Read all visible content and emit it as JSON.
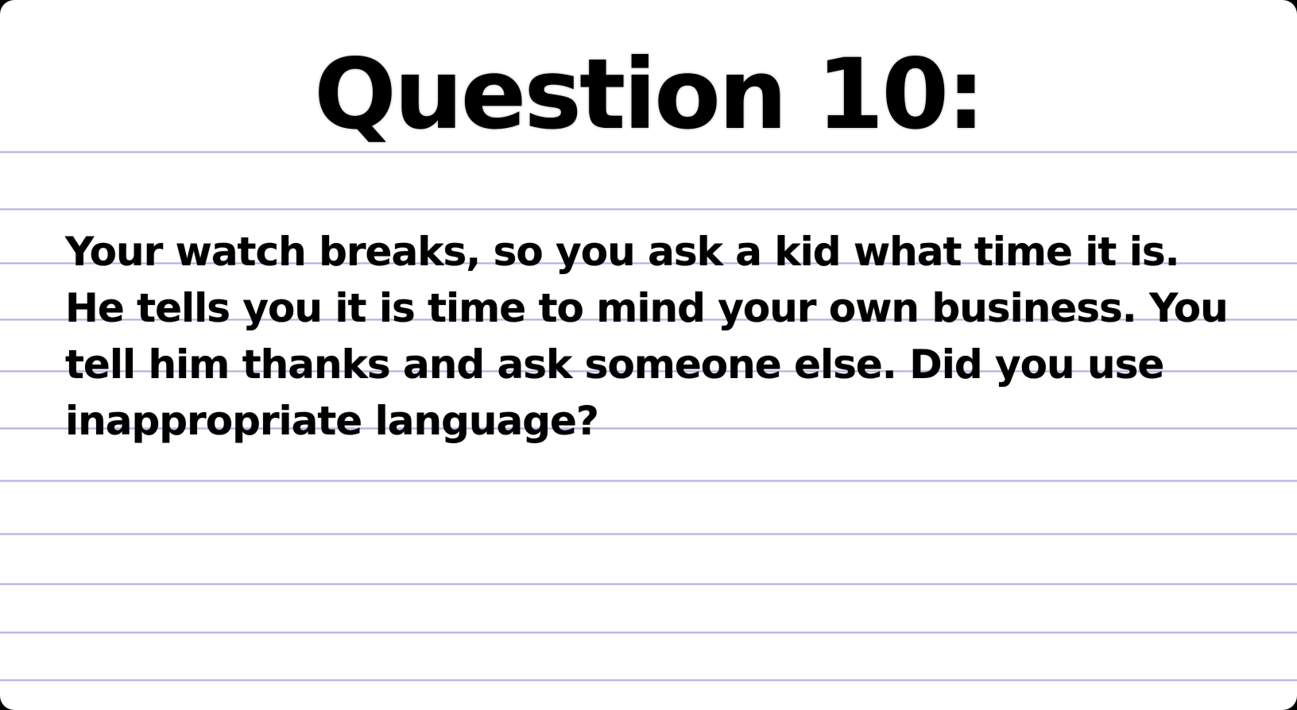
{
  "slide": {
    "title": "Question 10:",
    "question_text": "Your watch breaks, so you ask a kid what time it is. He tells you it is time to mind your own business. You tell him thanks and ask someone else. Did you use inappropriate language?"
  },
  "colors": {
    "background": "#ffffff",
    "rule_line": "#a8a8e0",
    "text": "#000000"
  }
}
